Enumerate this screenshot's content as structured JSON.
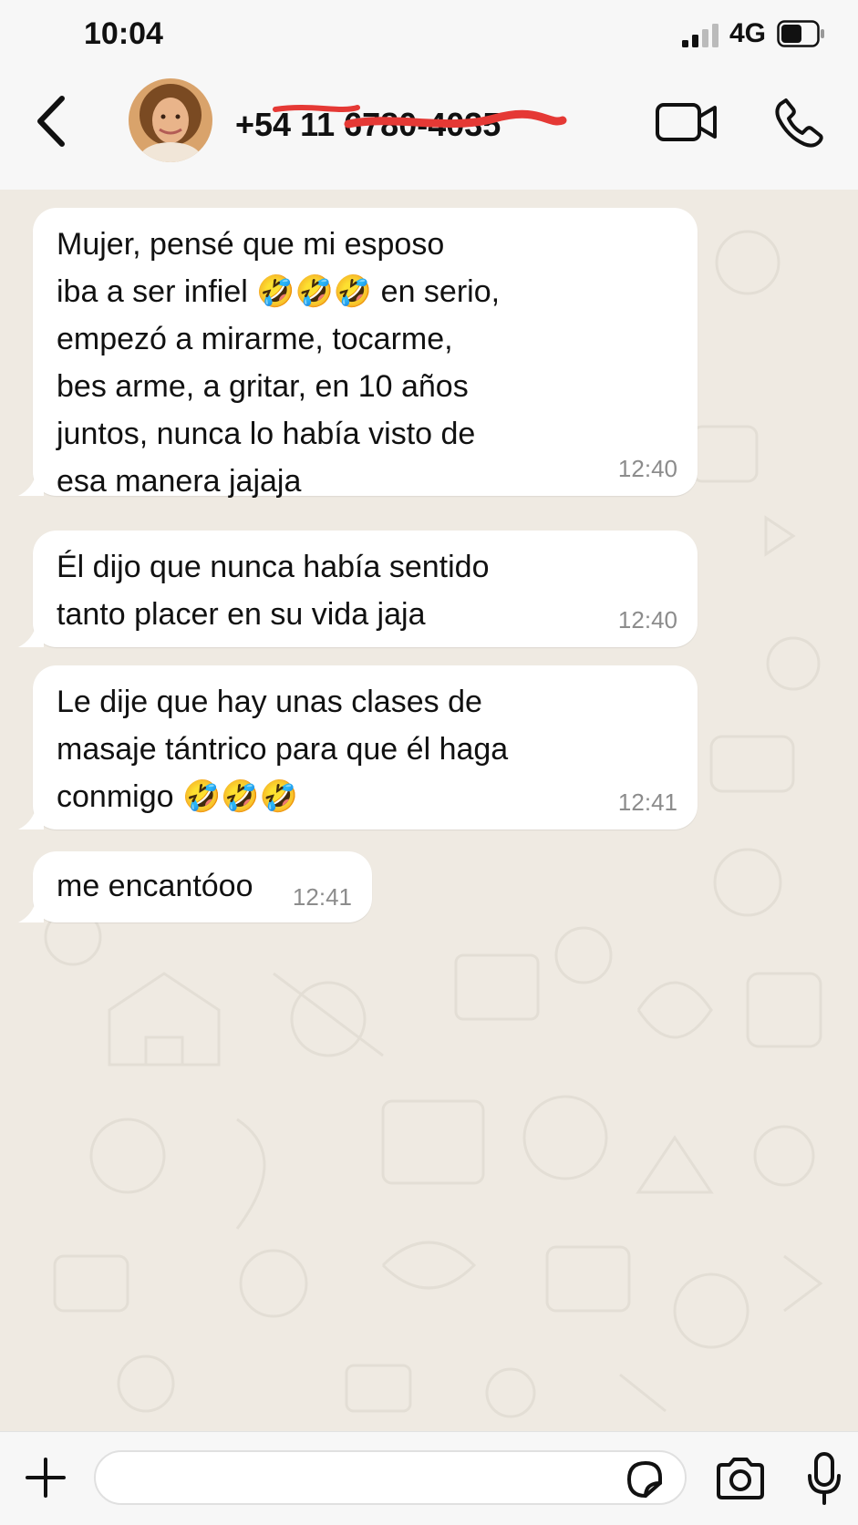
{
  "status_bar": {
    "time": "10:04",
    "network": "4G"
  },
  "header": {
    "contact": "+54 11 6780-4035"
  },
  "messages": [
    {
      "text": "Mujer, pensé que mi esposo\niba a ser infiel 🤣🤣🤣 en serio,\nempezó a mirarme, tocarme,\nbes arme, a gritar, en 10 años\njuntos, nunca lo había visto de\nesa manera jajaja",
      "time": "12:40"
    },
    {
      "text": "Él dijo que nunca había sentido\ntanto placer en su vida jaja",
      "time": "12:40"
    },
    {
      "text": "Le dije que hay unas clases de\nmasaje tántrico para que él haga\nconmigo 🤣🤣🤣",
      "time": "12:41"
    },
    {
      "text": "me encantóoo",
      "time": "12:41"
    }
  ],
  "input": {
    "placeholder": ""
  },
  "icons": {
    "back": "chevron-left-icon",
    "video": "video-camera-icon",
    "call": "phone-icon",
    "plus": "plus-icon",
    "sticker": "sticker-icon",
    "camera": "camera-icon",
    "mic": "microphone-icon"
  },
  "colors": {
    "chat_background": "#efeae2",
    "bubble": "#ffffff",
    "timestamp": "#8c8c8c",
    "redaction": "#e53935"
  }
}
